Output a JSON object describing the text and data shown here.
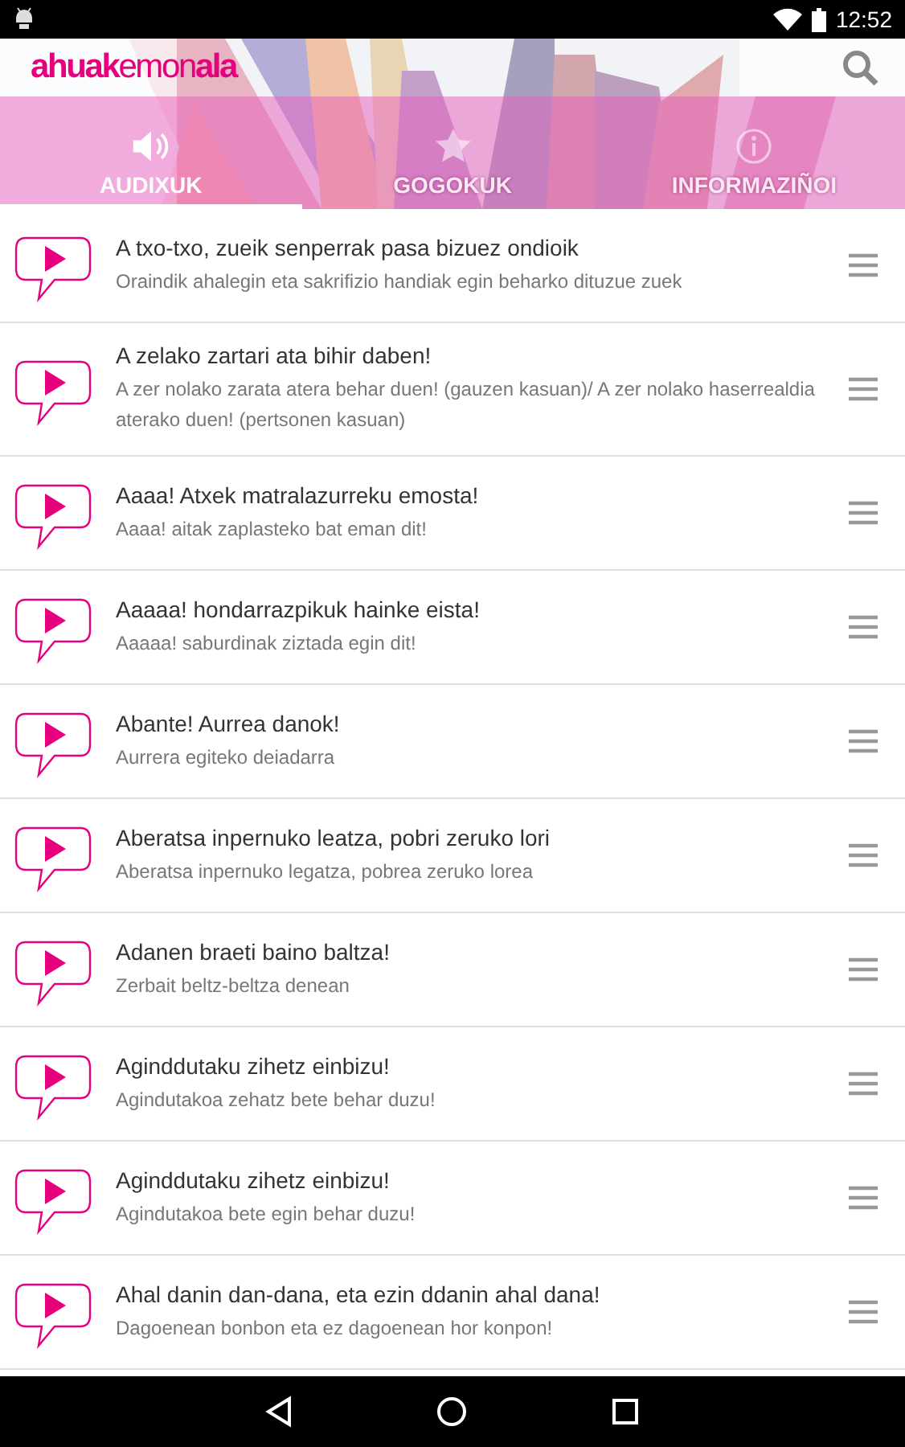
{
  "status_bar": {
    "time": "12:52"
  },
  "app_bar": {
    "logo": "**ahuak**emon**ala**"
  },
  "tabs": [
    {
      "label": "AUDIXUK",
      "kind": "speaker",
      "selected": true
    },
    {
      "label": "GOGOKUK",
      "kind": "star",
      "selected": false
    },
    {
      "label": "INFORMAZIÑOI",
      "kind": "info",
      "selected": false
    }
  ],
  "items": [
    {
      "title": "A txo-txo, zueik senperrak pasa bizuez ondioik",
      "subtitle": "Oraindik ahalegin eta sakrifizio handiak egin beharko dituzue zuek"
    },
    {
      "title": "A zelako zartari ata bihir daben!",
      "subtitle": "A zer nolako zarata atera behar duen! (gauzen kasuan)/ A zer nolako haserrealdia aterako duen! (pertsonen kasuan)"
    },
    {
      "title": "Aaaa! Atxek matralazurreku emosta!",
      "subtitle": "Aaaa! aitak zaplasteko bat eman dit!"
    },
    {
      "title": "Aaaaa! hondarrazpikuk hainke eista!",
      "subtitle": "Aaaaa! saburdinak ziztada egin dit!"
    },
    {
      "title": "Abante! Aurrea danok!",
      "subtitle": "Aurrera egiteko deiadarra"
    },
    {
      "title": "Aberatsa inpernuko leatza, pobri zeruko lori",
      "subtitle": "Aberatsa inpernuko legatza, pobrea zeruko lorea"
    },
    {
      "title": "Adanen braeti baino baltza!",
      "subtitle": "Zerbait beltz-beltza denean"
    },
    {
      "title": "Aginddutaku zihetz einbizu!",
      "subtitle": "Agindutakoa zehatz bete behar duzu!"
    },
    {
      "title": "Aginddutaku zihetz einbizu!",
      "subtitle": "Agindutakoa bete egin behar duzu!"
    },
    {
      "title": "Ahal danin dan-dana, eta ezin ddanin ahal dana!",
      "subtitle": "Dagoenean bonbon eta ez dagoenean hor konpon!"
    }
  ]
}
